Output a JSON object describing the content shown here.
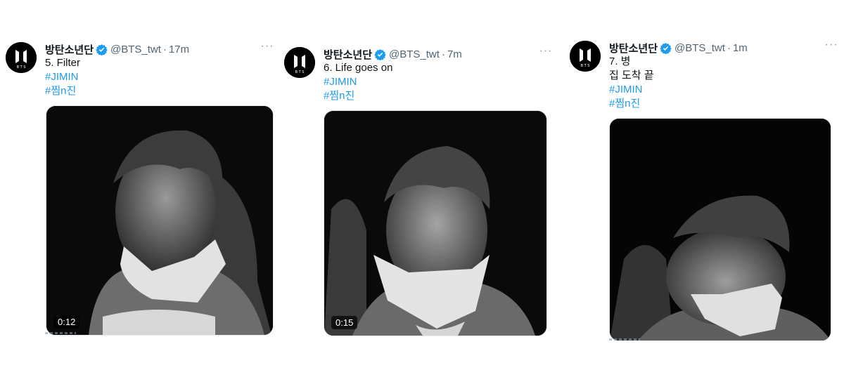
{
  "tweets": [
    {
      "author": "방탄소년단",
      "handle": "@BTS_twt",
      "time": "17m",
      "lines": [
        "5. Filter"
      ],
      "hashtags": [
        "#JIMIN",
        "#찜n진"
      ],
      "duration": "0:12"
    },
    {
      "author": "방탄소년단",
      "handle": "@BTS_twt",
      "time": "7m",
      "lines": [
        "6. Life goes on"
      ],
      "hashtags": [
        "#JIMIN",
        "#찜n진"
      ],
      "duration": "0:15"
    },
    {
      "author": "방탄소년단",
      "handle": "@BTS_twt",
      "time": "1m",
      "lines": [
        "7. 병",
        "집 도착 끝"
      ],
      "hashtags": [
        "#JIMIN",
        "#찜n진"
      ],
      "duration": ""
    }
  ],
  "ui": {
    "separator": "·",
    "more": "···"
  },
  "colors": {
    "link": "#1d9bf0",
    "secondary_text": "#536471",
    "verified": "#1d9bf0"
  },
  "icons": {
    "avatar": "bts-logo-icon",
    "badge": "verified-badge-icon",
    "menu": "more-icon"
  }
}
